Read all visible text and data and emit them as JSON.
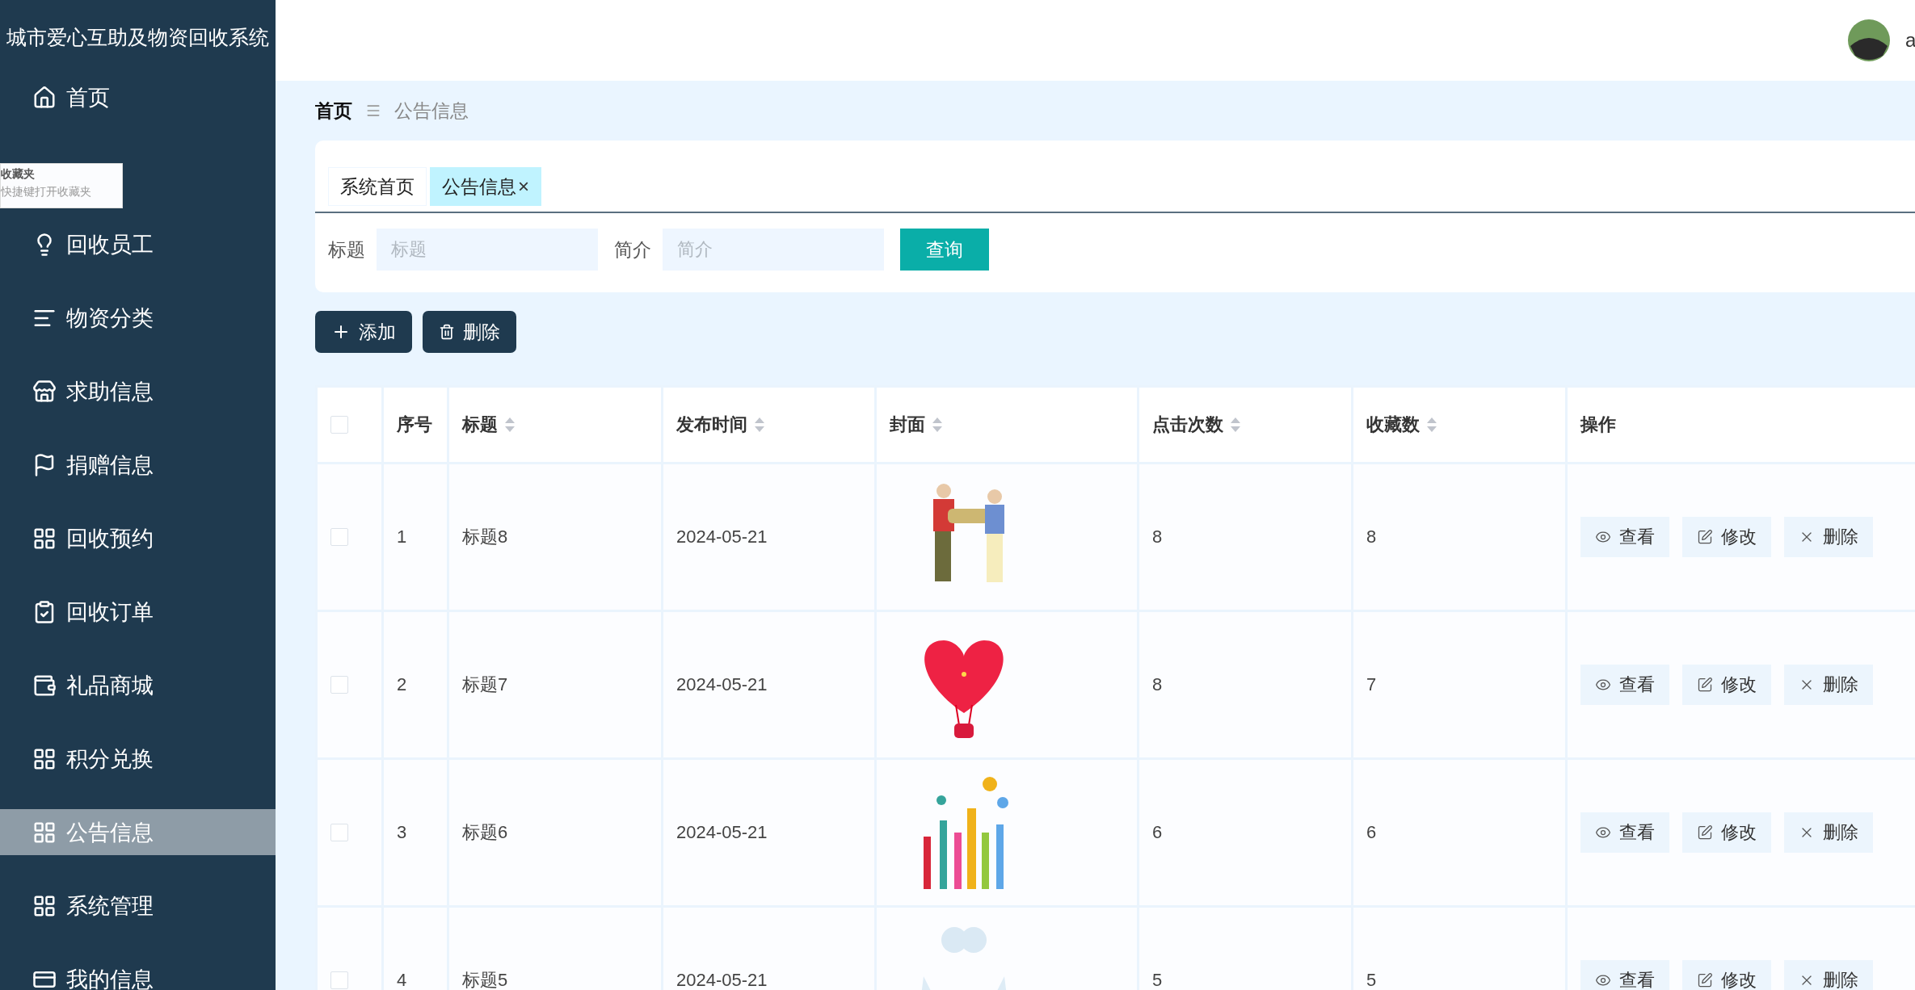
{
  "sidebar": {
    "title": "城市爱心互助及物资回收系统",
    "items": [
      {
        "label": "首页",
        "selected": false
      },
      {
        "label": "回收员工",
        "selected": false
      },
      {
        "label": "物资分类",
        "selected": false
      },
      {
        "label": "求助信息",
        "selected": false
      },
      {
        "label": "捐赠信息",
        "selected": false
      },
      {
        "label": "回收预约",
        "selected": false
      },
      {
        "label": "回收订单",
        "selected": false
      },
      {
        "label": "礼品商城",
        "selected": false
      },
      {
        "label": "积分兑换",
        "selected": false
      },
      {
        "label": "公告信息",
        "selected": true
      },
      {
        "label": "系统管理",
        "selected": false
      },
      {
        "label": "我的信息",
        "selected": false
      }
    ]
  },
  "tooltip": {
    "title": "收藏夹",
    "hint": "快捷键打开收藏夹"
  },
  "header": {
    "username": "a"
  },
  "breadcrumb": {
    "home": "首页",
    "current": "公告信息"
  },
  "tabs": [
    {
      "label": "系统首页",
      "selected": false,
      "closable": false
    },
    {
      "label": "公告信息",
      "selected": true,
      "closable": true,
      "close": "×"
    }
  ],
  "search": {
    "fields": [
      {
        "label": "标题",
        "placeholder": "标题"
      },
      {
        "label": "简介",
        "placeholder": "简介"
      }
    ],
    "button": "查询"
  },
  "toolbar": [
    {
      "kind": "add",
      "label": "添加"
    },
    {
      "kind": "delete",
      "label": "删除"
    }
  ],
  "table": {
    "columns": [
      {
        "kind": "check",
        "checked": false
      },
      {
        "label": "序号",
        "sortable": false
      },
      {
        "label": "标题",
        "sortable": true
      },
      {
        "label": "发布时间",
        "sortable": true
      },
      {
        "label": "封面",
        "sortable": true
      },
      {
        "label": "点击次数",
        "sortable": true
      },
      {
        "label": "收藏数",
        "sortable": true
      },
      {
        "label": "操作",
        "sortable": false
      }
    ],
    "rows": [
      {
        "checked": false,
        "index": "1",
        "title": "标题8",
        "date": "2024-05-21",
        "cover": {
          "kind": "picture"
        },
        "clicks": "8",
        "favorites": "8",
        "actions": [
          {
            "kind": "view",
            "label": "查看"
          },
          {
            "kind": "edit",
            "label": "修改"
          },
          {
            "kind": "delete",
            "label": "删除"
          }
        ]
      },
      {
        "checked": false,
        "index": "2",
        "title": "标题7",
        "date": "2024-05-21",
        "cover": {
          "kind": "picture"
        },
        "clicks": "8",
        "favorites": "7",
        "actions": [
          {
            "kind": "view",
            "label": "查看"
          },
          {
            "kind": "edit",
            "label": "修改"
          },
          {
            "kind": "delete",
            "label": "删除"
          }
        ]
      },
      {
        "checked": false,
        "index": "3",
        "title": "标题6",
        "date": "2024-05-21",
        "cover": {
          "kind": "picture"
        },
        "clicks": "6",
        "favorites": "6",
        "actions": [
          {
            "kind": "view",
            "label": "查看"
          },
          {
            "kind": "edit",
            "label": "修改"
          },
          {
            "kind": "delete",
            "label": "删除"
          }
        ]
      },
      {
        "checked": false,
        "index": "4",
        "title": "标题5",
        "date": "2024-05-21",
        "cover": {
          "kind": "picture"
        },
        "clicks": "5",
        "favorites": "5",
        "actions": [
          {
            "kind": "view",
            "label": "查看"
          },
          {
            "kind": "edit",
            "label": "修改"
          },
          {
            "kind": "delete",
            "label": "删除"
          }
        ]
      }
    ]
  }
}
